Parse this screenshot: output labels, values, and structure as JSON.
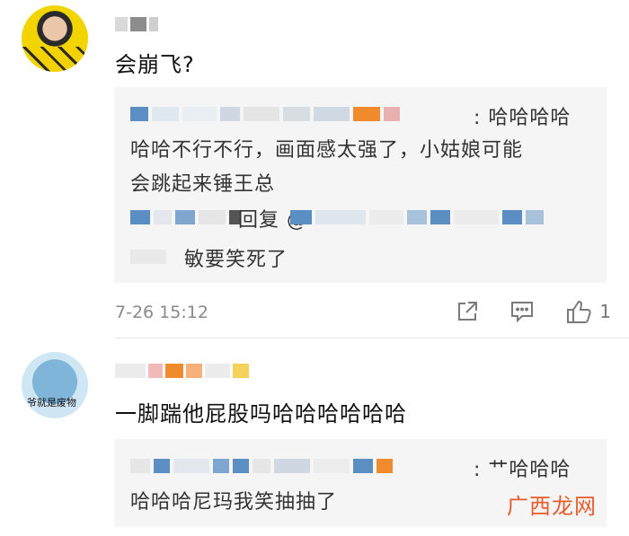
{
  "comment1": {
    "text": "会崩飞?",
    "reply": {
      "line1_tail": ": 哈哈哈哈",
      "line2": "哈哈不行不行，画面感太强了，小姑娘可能",
      "line3": "会跳起来锤王总",
      "sub_reply_mid": "回复 @",
      "sub_reply_tail": "敏要笑死了"
    },
    "time": "7-26 15:12",
    "like_count": "1"
  },
  "comment2": {
    "avatar_text": "爷就是废物",
    "text": "一脚踹他屁股吗哈哈哈哈哈哈",
    "reply": {
      "line1_tail": ": 艹哈哈哈",
      "line2": "哈哈哈尼玛我笑抽抽了"
    }
  },
  "watermark": "广西龙网",
  "colors": {
    "accent_orange": "#f08a2c",
    "blur_blue": "#5b8fc4",
    "watermark": "#e85c2a"
  },
  "icons": [
    "share-icon",
    "comment-icon",
    "like-icon"
  ]
}
